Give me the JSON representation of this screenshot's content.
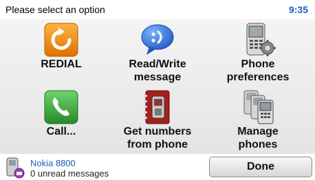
{
  "header": {
    "prompt": "Please select an option",
    "time": "9:35"
  },
  "menu": {
    "items": [
      {
        "line1": "REDIAL",
        "line2": "",
        "icon": "redial-icon"
      },
      {
        "line1": "Read/Write",
        "line2": "message",
        "icon": "message-bubble-icon"
      },
      {
        "line1": "Phone",
        "line2": "preferences",
        "icon": "phone-settings-icon"
      },
      {
        "line1": "Call...",
        "line2": "",
        "icon": "call-handset-icon"
      },
      {
        "line1": "Get numbers",
        "line2": "from phone",
        "icon": "phonebook-icon"
      },
      {
        "line1": "Manage",
        "line2": "phones",
        "icon": "multiple-phones-icon"
      }
    ]
  },
  "footer": {
    "device_name": "Nokia 8800",
    "status": "0 unread messages",
    "done_label": "Done"
  },
  "colors": {
    "accent": "#1a5fb4",
    "redial": "#f08a1c",
    "call": "#3aa53a",
    "message": "#2a6fd6",
    "phonebook": "#a5201c"
  }
}
